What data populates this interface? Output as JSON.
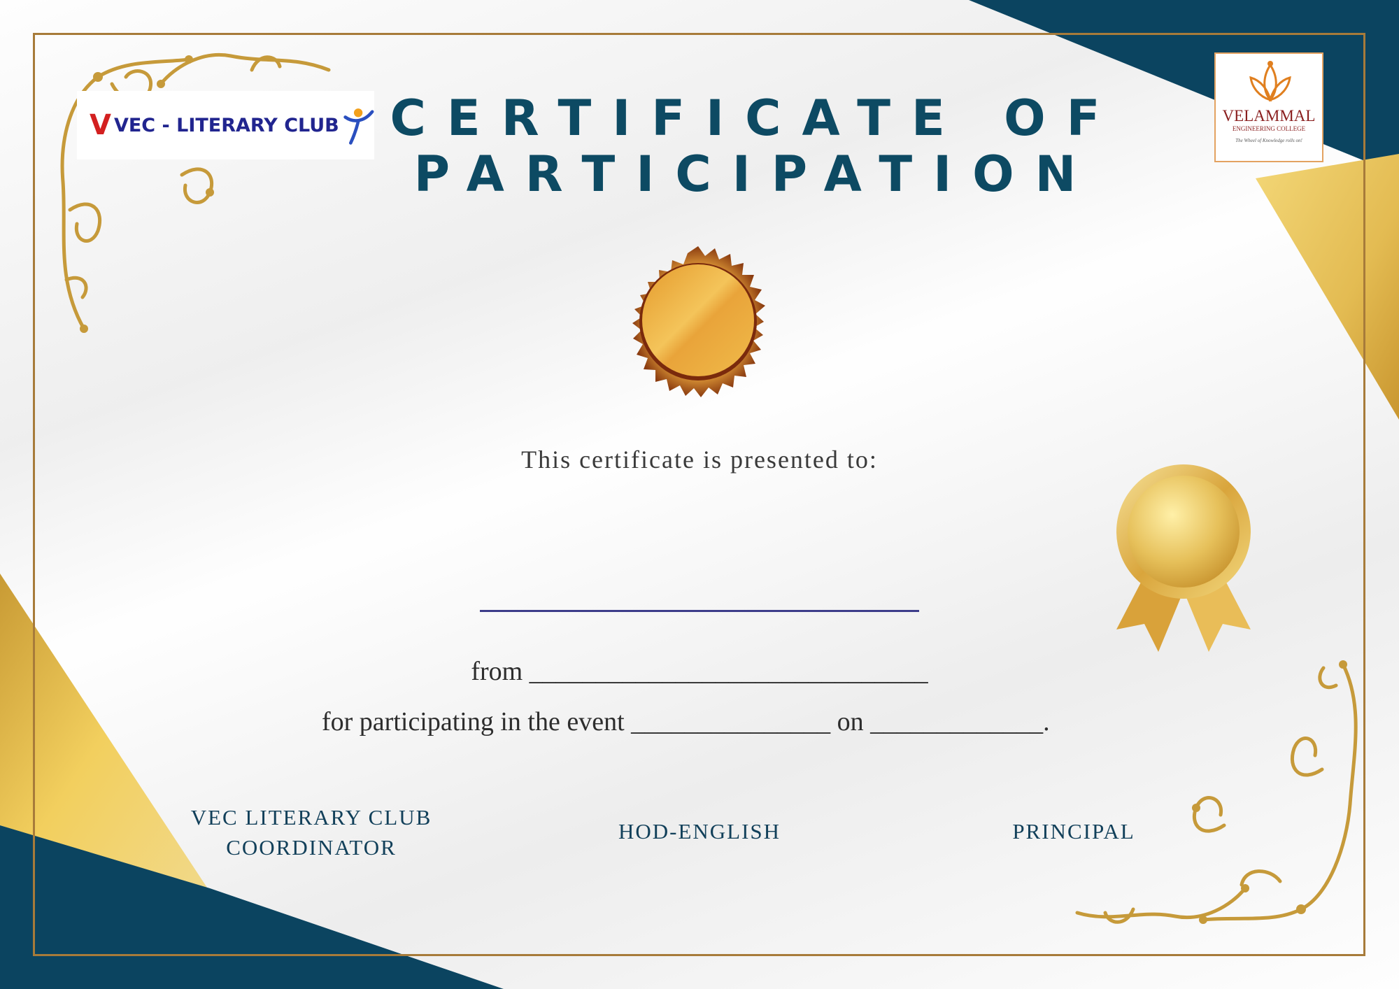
{
  "certificate": {
    "title_line1": "CERTIFICATE OF",
    "title_line2": "PARTICIPATION",
    "presented_to": "This certificate is presented to:",
    "from_line": "from ______________________________",
    "event_line": "for participating in the event _______________ on _____________."
  },
  "logos": {
    "club": {
      "mark": "V",
      "text": "VEC - LITERARY CLUB"
    },
    "college": {
      "name": "VELAMMAL",
      "subtitle": "ENGINEERING COLLEGE",
      "tagline": "The Wheel of Knowledge rolls on!"
    }
  },
  "signatories": {
    "coordinator_line1": "VEC LITERARY CLUB",
    "coordinator_line2": "COORDINATOR",
    "hod": "HOD-ENGLISH",
    "principal": "PRINCIPAL"
  },
  "colors": {
    "navy": "#0d4a63",
    "gold": "#e8c25a",
    "frame": "#a77b3a",
    "text": "#2d2d2d"
  },
  "icons": [
    "gold-seal-icon",
    "medal-ribbon-icon",
    "floral-ornament-icon"
  ]
}
